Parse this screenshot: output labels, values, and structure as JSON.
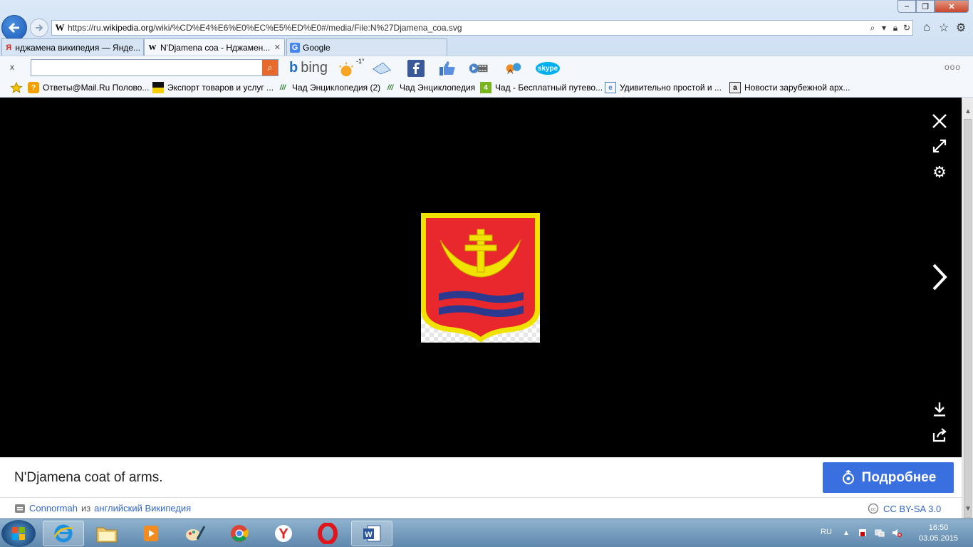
{
  "window": {
    "minimize_label": "‒",
    "maximize_label": "❐",
    "close_label": "✕"
  },
  "address": {
    "favicon": "W",
    "url_prefix": "https://ru.",
    "url_domain": "wikipedia.org",
    "url_path": "/wiki/%CD%E4%E6%E0%EC%E5%ED%E0#/media/File:N%27Djamena_coa.svg"
  },
  "tabs": [
    {
      "favicon": "Я",
      "label": "нджамена википедия — Янде...",
      "fav_color": "#d9261c"
    },
    {
      "favicon": "W",
      "label": "N'Djamena coa - Нджамен...",
      "close": "✕"
    },
    {
      "favicon": "G",
      "label": "Google",
      "fav_color": "#4285f4"
    }
  ],
  "command_bar": {
    "close": "x",
    "search_placeholder": "",
    "bing_label": "bing",
    "weather": "-1°",
    "more": "ooo"
  },
  "favorites": [
    {
      "label": "Ответы@Mail.Ru Полово..."
    },
    {
      "label": "Экспорт товаров и услуг ..."
    },
    {
      "label": "Чад  Энциклопедия (2)"
    },
    {
      "label": "Чад  Энциклопедия"
    },
    {
      "label": "Чад - Бесплатный путево..."
    },
    {
      "label": "Удивительно простой и ..."
    },
    {
      "label": "Новости зарубежной арх..."
    }
  ],
  "viewer": {
    "image_title": "N'Djamena coat of arms",
    "caption": "N'Djamena coat of arms.",
    "more_button": "Подробнее",
    "author": "Connormah",
    "author_from": "из",
    "source": "английский Википедия",
    "license": "CC BY-SA 3.0"
  },
  "coat_of_arms_colors": {
    "field": "#e8282c",
    "border": "#f2e200",
    "waves": "#2b3a8f"
  },
  "taskbar": {
    "language": "RU",
    "time": "16:50",
    "date": "03.05.2015"
  }
}
